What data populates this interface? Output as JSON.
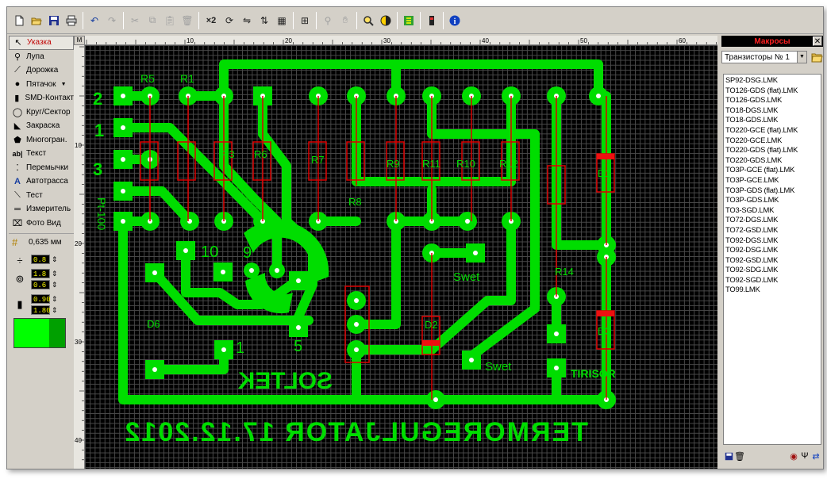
{
  "toolbar": {
    "buttons": [
      "new-icon",
      "open-icon",
      "save-icon",
      "print-icon",
      "undo-icon",
      "redo-icon",
      "cut-icon",
      "copy-icon",
      "paste-icon",
      "delete-icon",
      "duplicate-icon",
      "rotate-icon",
      "mirror-h-icon",
      "mirror-v-icon",
      "group-icon",
      "align-icon",
      "snap-icon",
      "hand-icon",
      "zoom-icon",
      "contrast-icon",
      "macro-icon",
      "component-icon",
      "info-icon"
    ],
    "duplicate_label": "×2"
  },
  "tools": [
    {
      "label": "Указка",
      "icon": "pointer-icon",
      "active": true
    },
    {
      "label": "Лупа",
      "icon": "magnifier-icon"
    },
    {
      "label": "Дорожка",
      "icon": "track-icon"
    },
    {
      "label": "Пятачок",
      "icon": "pad-icon"
    },
    {
      "label": "SMD-Контакт",
      "icon": "smd-pad-icon"
    },
    {
      "label": "Круг/Сектор",
      "icon": "circle-icon"
    },
    {
      "label": "Закраска",
      "icon": "fill-icon"
    },
    {
      "label": "Многогран.",
      "icon": "polygon-icon"
    },
    {
      "label": "Текст",
      "icon": "text-icon"
    },
    {
      "label": "Перемычки",
      "icon": "jumper-icon"
    },
    {
      "label": "Автотрасса",
      "icon": "autoroute-icon"
    },
    {
      "label": "Тест",
      "icon": "test-icon"
    },
    {
      "label": "Измеритель",
      "icon": "ruler-icon"
    },
    {
      "label": "Фото Вид",
      "icon": "photo-view-icon"
    }
  ],
  "grid_size": "0,635 мм",
  "params": {
    "track_width": "0.8",
    "pad_outer": "1.8",
    "pad_inner": "0.6",
    "smd_w": "0.90",
    "smd_h": "1.80"
  },
  "colors": {
    "copper": "#00dd00",
    "resistor": "#dd0000",
    "canvas": "#000000",
    "layer_active": "#00ff00",
    "layer_alt": "#00a000"
  },
  "ruler": {
    "corner": "M",
    "h_labels": [
      "10",
      "20",
      "30",
      "40",
      "50",
      "60"
    ],
    "v_labels": [
      "10",
      "20",
      "30",
      "40"
    ]
  },
  "board_labels": {
    "conn_2": "2",
    "conn_1": "1",
    "conn_3": "3",
    "r5": "R5",
    "r1": "R1",
    "r3": "R3",
    "r6": "R6",
    "r7": "R7",
    "r8": "R8",
    "r9": "R9",
    "r11": "R11",
    "r10": "R10",
    "r12": "R12",
    "r14": "R14",
    "d1": "D1",
    "d2": "D2",
    "d3": "D3",
    "d6": "D6",
    "pt100": "Pt-100",
    "t10": "10",
    "t9": "9",
    "t7": "7",
    "t5": "5",
    "t1": "1",
    "swet1": "Swet",
    "swet2": "Swet",
    "tirisor": "TIRISOR",
    "soltek": "SOLTEK",
    "title": "TERMOREGULJATOR 17.12.2012"
  },
  "macros": {
    "title": "Макросы",
    "close": "✕",
    "selected": "Транзисторы № 1",
    "items": [
      "SP92-DSG.LMK",
      "TO126-GDS (flat).LMK",
      "TO126-GDS.LMK",
      "TO18-DGS.LMK",
      "TO18-GDS.LMK",
      "TO220-GCE (flat).LMK",
      "TO220-GCE.LMK",
      "TO220-GDS (flat).LMK",
      "TO220-GDS.LMK",
      "TO3P-GCE (flat).LMK",
      "TO3P-GCE.LMK",
      "TO3P-GDS (flat).LMK",
      "TO3P-GDS.LMK",
      "TO3-SGD.LMK",
      "TO72-DGS.LMK",
      "TO72-GSD.LMK",
      "TO92-DGS.LMK",
      "TO92-DSG.LMK",
      "TO92-GSD.LMK",
      "TO92-SDG.LMK",
      "TO92-SGD.LMK",
      "TO99.LMK"
    ]
  }
}
